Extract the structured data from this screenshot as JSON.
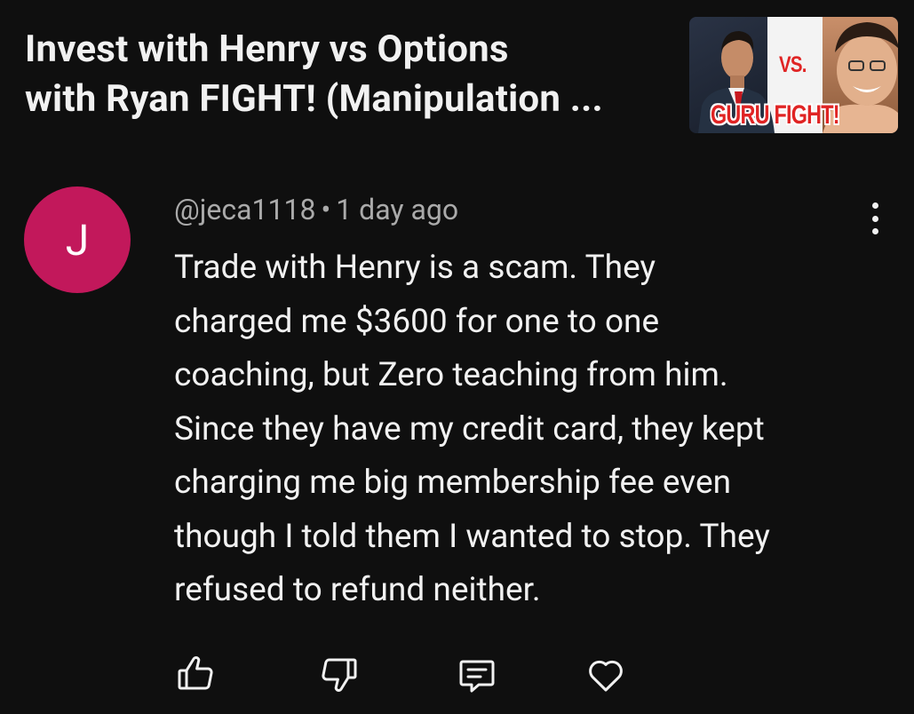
{
  "video": {
    "title_lines": [
      "Invest with Henry vs Options",
      "with Ryan FIGHT! (Manipulation ..."
    ],
    "thumbnail": {
      "vs_text": "VS.",
      "fight_text": "GURU FIGHT!"
    }
  },
  "comment": {
    "avatar_letter": "J",
    "avatar_color": "#c2185b",
    "author": "@jeca1118",
    "separator": "•",
    "time": "1 day ago",
    "body_lines": [
      "Trade with Henry is a scam.  They",
      "charged me $3600 for one to one",
      "coaching, but Zero teaching from him.",
      "Since they have my credit card, they kept",
      "charging me big membership fee even",
      "though I told them I wanted to stop.  They",
      "refused to refund neither."
    ]
  },
  "actions": {
    "like_icon": "thumbs-up-icon",
    "dislike_icon": "thumbs-down-icon",
    "reply_icon": "comment-icon",
    "heart_icon": "heart-icon"
  }
}
